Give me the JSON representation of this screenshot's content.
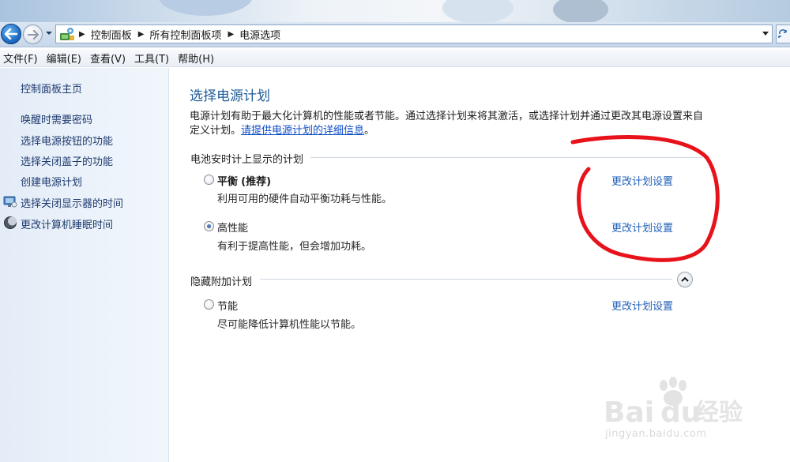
{
  "nav": {
    "breadcrumb": [
      "控制面板",
      "所有控制面板项",
      "电源选项"
    ]
  },
  "menu": [
    "文件(F)",
    "编辑(E)",
    "查看(V)",
    "工具(T)",
    "帮助(H)"
  ],
  "sidebar": {
    "home": "控制面板主页",
    "links": [
      "唤醒时需要密码",
      "选择电源按钮的功能",
      "选择关闭盖子的功能",
      "创建电源计划",
      "选择关闭显示器的时间",
      "更改计算机睡眠时间"
    ]
  },
  "main": {
    "title": "选择电源计划",
    "desc_text": "电源计划有助于最大化计算机的性能或者节能。通过选择计划来将其激活，或选择计划并通过更改其电源设置来自定义计划。",
    "desc_link": "请提供电源计划的详细信息",
    "desc_end": "。",
    "battery_group": "电池安时计上显示的计划",
    "hidden_group": "隐藏附加计划",
    "change_link": "更改计划设置",
    "plans": [
      {
        "name": "平衡",
        "tag": "(推荐)",
        "desc": "利用可用的硬件自动平衡功耗与性能。",
        "selected": false
      },
      {
        "name": "高性能",
        "desc": "有利于提高性能，但会增加功耗。",
        "selected": true
      },
      {
        "name": "节能",
        "desc": "尽可能降低计算机性能以节能。",
        "selected": false
      }
    ]
  },
  "watermark": {
    "brand": "Bai",
    "brand2": "du",
    "brand_cn": "经验",
    "url": "jingyan.baidu.com"
  },
  "colors": {
    "title_blue": "#1e5c9a",
    "link_blue": "#1f5fb7",
    "annotation_red": "#e8121b"
  }
}
